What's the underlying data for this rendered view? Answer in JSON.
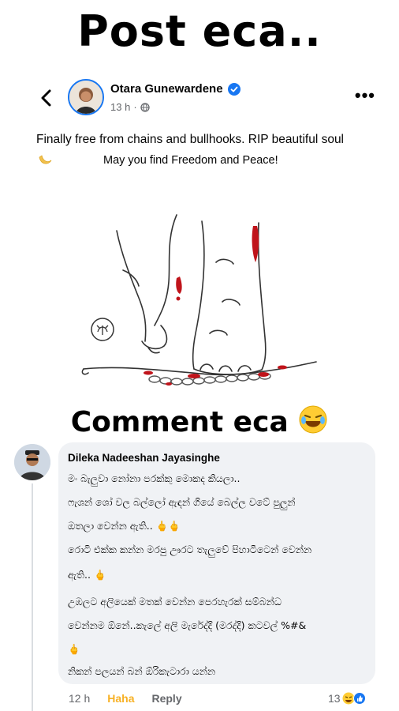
{
  "banners": {
    "top": "Post eca..",
    "bottom": "Comment eca"
  },
  "post": {
    "author": "Otara Gunewardene",
    "time": "13 h",
    "more": "•••",
    "caption_line1": "Finally free from chains and bullhooks. RIP beautiful soul",
    "caption_line2": "May you find Freedom and Peace!"
  },
  "comment": {
    "author": "Dileka Nadeeshan Jayasinghe",
    "lines": [
      "මං බැලුවා නෝනා පරක්කු මොකද කියලා..",
      "ෆැශන් ශෝ වල බල්ලෝ ඇඳන් ගියේ බෙල්ල වටේ පුලුන්",
      "ඔතලා වෙන්න ඇති..",
      "රොටි එක්ක කන්න මරපු ඌරට තැලුවේ පිහාටීටෙන් වෙන්න",
      "ඇති..",
      "උඹලට අලියෙක් මතක් වෙන්න පෙරහැරක් සම්බන්ධ",
      "වෙන්නම ඕනේ..කැලේ අලි මැරේද්දි (මරද්දි) කටවල් %#&",
      "",
      "නිකන් පලයන් බන් ඕරිකැටාරා යන්න"
    ],
    "time": "12 h",
    "haha": "Haha",
    "reply": "Reply",
    "reactions": "13"
  },
  "icons": {
    "back": "chevron-left-icon",
    "verified": "verified-badge-icon",
    "globe": "public-globe-icon",
    "moon": "crescent-moon-icon",
    "laugh": "laughing-emoji-icon",
    "like": "like-reaction-icon",
    "middle_finger": "middle-finger-emoji-icon"
  },
  "colors": {
    "facebook_blue": "#1877f2",
    "blood": "#c0141b",
    "haha": "#f7b125"
  }
}
